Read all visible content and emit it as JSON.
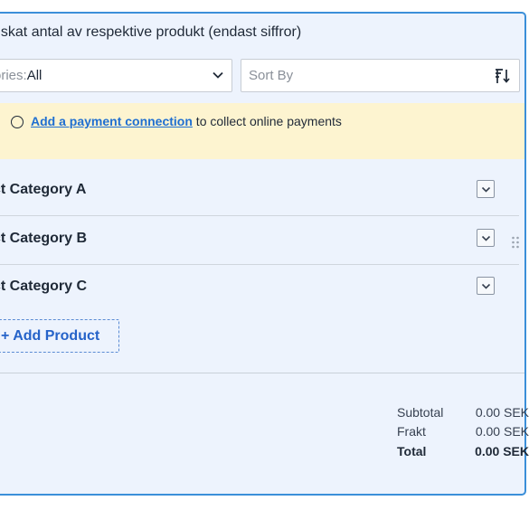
{
  "form": {
    "question": "nskat antal av respektive produkt (endast siffror)"
  },
  "filters": {
    "categories_prefix": "ories: ",
    "categories_value": "All",
    "sort_placeholder": "Sort By"
  },
  "notice": {
    "link_text": "Add a payment connection",
    "rest_text": " to collect online payments"
  },
  "categories": [
    {
      "label": "ct Category A"
    },
    {
      "label": "ct Category B"
    },
    {
      "label": "ct Category C"
    }
  ],
  "add_product": {
    "label": "+ Add Product"
  },
  "totals": {
    "subtotal_label": "Subtotal",
    "subtotal_value": "0.00 SEK",
    "frakt_label": "Frakt",
    "frakt_value": "0.00 SEK",
    "total_label": "Total",
    "total_value": "0.00 SEK"
  },
  "colors": {
    "accent": "#3b8fd9",
    "link": "#1f6fd1",
    "notice_bg": "#fdf4d0",
    "panel_bg": "#edf3fd"
  }
}
